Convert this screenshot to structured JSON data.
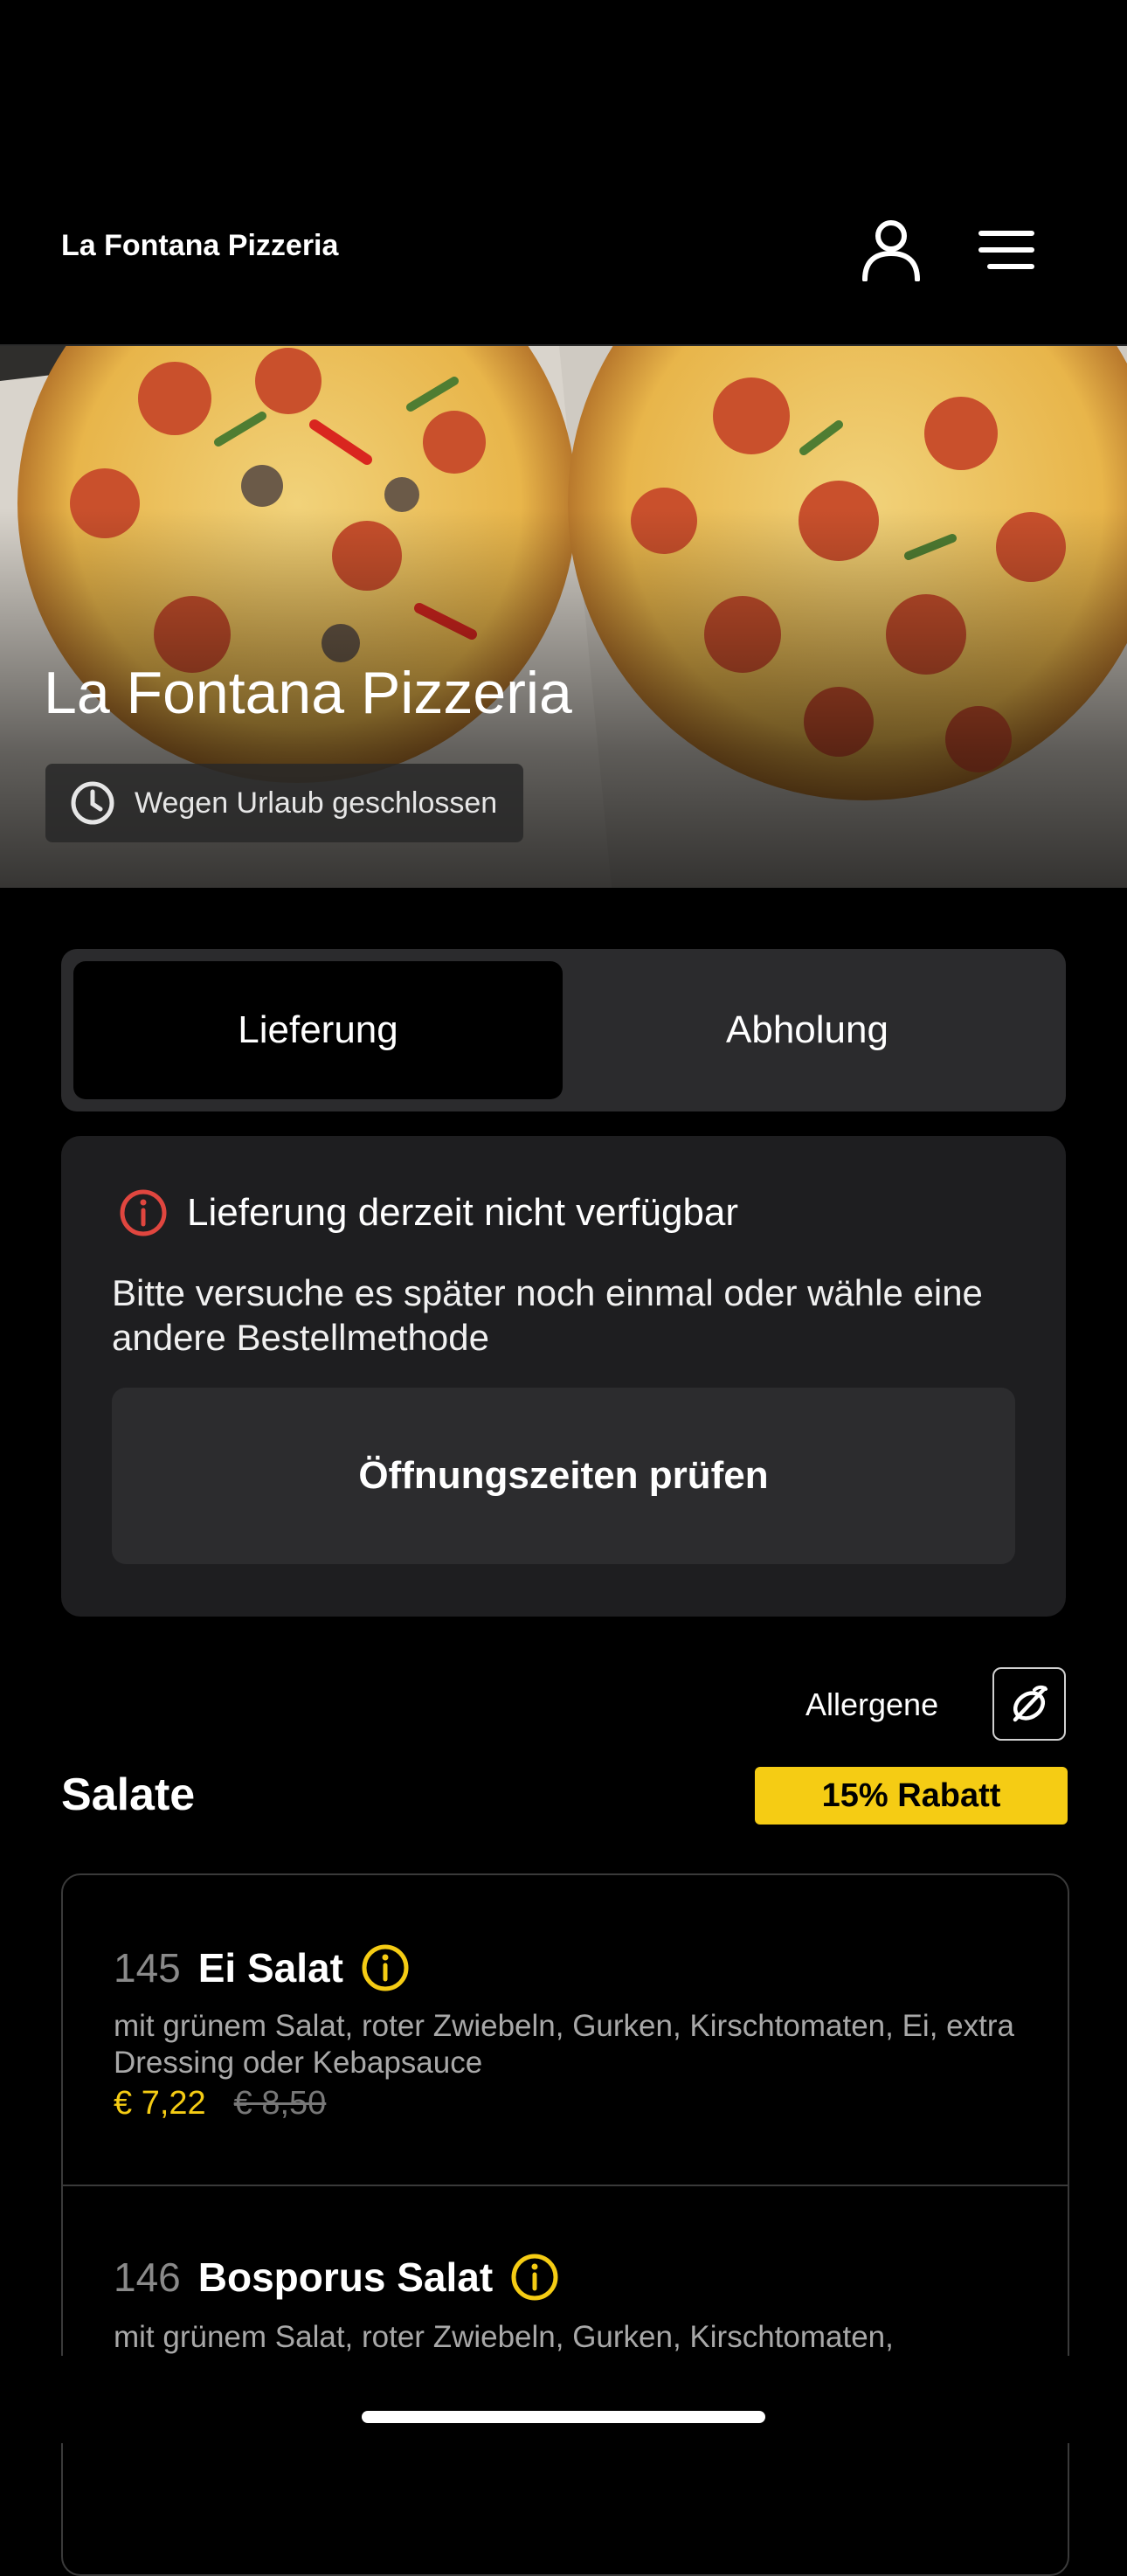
{
  "header": {
    "app_title": "La Fontana Pizzeria",
    "account_icon": "person-icon",
    "menu_icon": "hamburger-menu-icon"
  },
  "hero": {
    "restaurant_name": "La Fontana Pizzeria",
    "status_icon": "clock-icon",
    "status_text": "Wegen Urlaub geschlossen"
  },
  "order_mode": {
    "tabs": [
      {
        "label": "Lieferung",
        "selected": true
      },
      {
        "label": "Abholung",
        "selected": false
      }
    ]
  },
  "notice": {
    "icon": "info-circle-icon",
    "accent_color": "#e0463f",
    "title": "Lieferung derzeit nicht verfügbar",
    "body": "Bitte versuche es später noch einmal oder wähle eine andere Bestellmethode",
    "button_label": "Öffnungszeiten prüfen"
  },
  "allergens": {
    "label": "Allergene",
    "icon": "allergen-filter-icon"
  },
  "section": {
    "title": "Salate",
    "discount_badge": "15% Rabatt",
    "badge_color": "#f5cc14"
  },
  "items": [
    {
      "number": "145",
      "name": "Ei Salat",
      "info_icon": "info-circle-icon",
      "description": "mit grünem Salat, roter Zwiebeln, Gurken, Kirschtomaten, Ei, extra Dressing oder Kebapsauce",
      "price": "€ 7,22",
      "old_price": "€ 8,50"
    },
    {
      "number": "146",
      "name": "Bosporus Salat",
      "info_icon": "info-circle-icon",
      "description": "mit grünem Salat, roter Zwiebeln, Gurken, Kirschtomaten,"
    }
  ]
}
